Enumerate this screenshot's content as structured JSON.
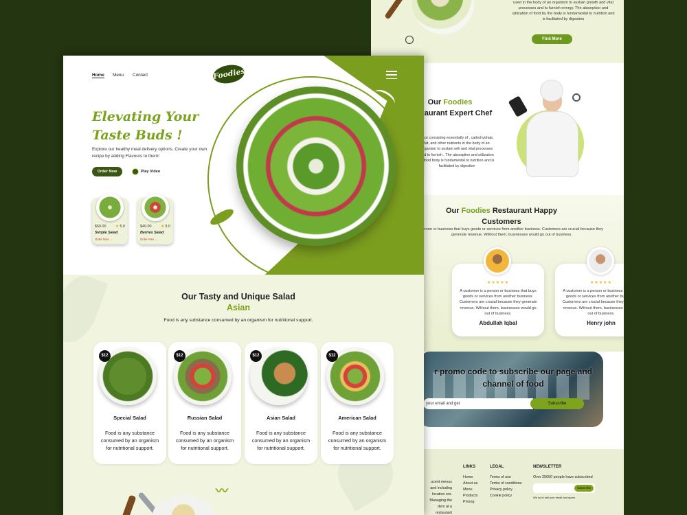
{
  "back": {
    "top_text": "used in the body of an organism to sustain growth and vital processes and to furnish energy. The absorption and utilization of food by the body is fundamental to nutrition and is facilitated by digestion",
    "find_more": "Find More",
    "chef_title_pre": "Our",
    "chef_title_acc": "Foodies",
    "chef_title_post": "Restaurant Expert Chef",
    "chef_text": "ance consisting essentially of , carbohydrate, fat, and other nutrients in the body of an organism to sustain wth and vital processes and to furnish . The absorption and utilization of food body is fundamental to nutrition and is facilitated by digestion",
    "cust_title_pre": "Our",
    "cust_title_acc": "Foodies",
    "cust_title_post": "Restaurant Happy Customers",
    "cust_sub": "person or business that buys goods or services from another business. Customers are crucial because they generate revenue. Without them, businesses would go out of business.",
    "testimonials": [
      {
        "text": "A customer is a person or business that buys goods or services from another business. Customers are crucial because they generate revenue. Without them, businesses would go out of business.",
        "name": "Abdullah Iqbal",
        "stars": "★★★★★"
      },
      {
        "text": "A customer is a person or business that buys goods or services from another business. Customers are crucial because they generate revenue. Without them, businesses would go out of business.",
        "name": "Henry john",
        "stars": "★★★★★"
      }
    ],
    "promo_title": "r promo code to subscribe our page and channel of food",
    "promo_placeholder": "your email and get",
    "subscribe": "Subscribe",
    "footer": {
      "links_title": "LINKS",
      "links": [
        "Home",
        "About us",
        "Menu",
        "Products",
        "Pricing"
      ],
      "legal_title": "LEGAL",
      "legal": [
        "Terms of use",
        "Terms of conditions",
        "Privacy policy",
        "Cookie policy"
      ],
      "news_title": "NEWSLETTER",
      "news_sub": "Over 25000 people have subscribed",
      "news_btn": "Subscribe",
      "news_note": "We don't sell your email and spam",
      "about": "ucent menus and including location ers. Managing the ders at a restaurant"
    }
  },
  "front": {
    "nav": [
      "Home",
      "Menu",
      "Contact"
    ],
    "logo": "Foodies",
    "hero_title": "Elevating Your Taste Buds !",
    "hero_sub": "Explore our healthy meal delivery options. Create your own recipe by adding Flavours to them!",
    "order_now": "Order Now",
    "play_video": "Play Video",
    "minis": [
      {
        "price": "$50.00",
        "rating": "5.0",
        "name": "Simple Salad",
        "order": "Order Now →"
      },
      {
        "price": "$40.00",
        "rating": "5.0",
        "name": "Berries Salad",
        "order": "Order Now →"
      }
    ],
    "menu_title": "Our Tasty and Unique Salad",
    "menu_acc": "Asian",
    "menu_sub": "Food is any substance consumed by an organism for nutritional support.",
    "salads": [
      {
        "price": "$12",
        "name": "Special Salad",
        "desc": "Food is any substance consumed by an organism for nutritional support."
      },
      {
        "price": "$12",
        "name": "Russian Salad",
        "desc": "Food is any substance consumed by an organism for nutritional support."
      },
      {
        "price": "$12",
        "name": "Asian Salad",
        "desc": "Food is any substance consumed by an organism for nutritional support."
      },
      {
        "price": "$12",
        "name": "American Salad",
        "desc": "Food is any substance consumed by an organism for nutritional support."
      }
    ]
  },
  "colors": {
    "accent": "#7aa21d",
    "dark_green": "#3b5612",
    "background": "#243511"
  }
}
